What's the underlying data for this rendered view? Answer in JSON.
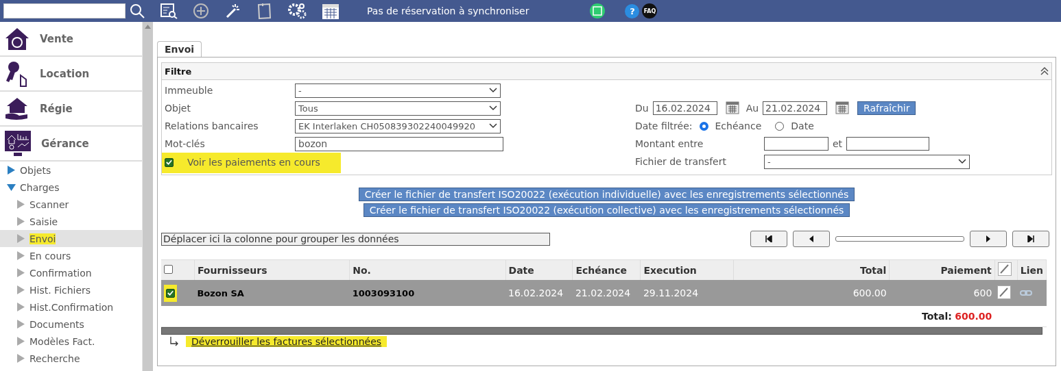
{
  "topbar": {
    "status": "Pas de réservation à synchroniser",
    "help": "?",
    "faq": "FAQ"
  },
  "sidebar": {
    "modules": [
      {
        "label": "Vente"
      },
      {
        "label": "Location"
      },
      {
        "label": "Régie"
      },
      {
        "label": "Gérance"
      }
    ],
    "tree": [
      {
        "label": "Objets",
        "expanded": false
      },
      {
        "label": "Charges",
        "expanded": true,
        "children": [
          {
            "label": "Scanner",
            "selected": false,
            "highlighted": false
          },
          {
            "label": "Saisie",
            "selected": false,
            "highlighted": false
          },
          {
            "label": "Envoi",
            "selected": true,
            "highlighted": true
          },
          {
            "label": "En cours",
            "selected": false,
            "highlighted": false
          },
          {
            "label": "Confirmation",
            "selected": false,
            "highlighted": false
          },
          {
            "label": "Hist. Fichiers",
            "selected": false,
            "highlighted": false
          },
          {
            "label": "Hist.Confirmation",
            "selected": false,
            "highlighted": false
          },
          {
            "label": "Documents",
            "selected": false,
            "highlighted": false
          },
          {
            "label": "Modèles Fact.",
            "selected": false,
            "highlighted": false
          },
          {
            "label": "Recherche",
            "selected": false,
            "highlighted": false
          }
        ]
      }
    ]
  },
  "tabs": [
    {
      "label": "Envoi",
      "selected": true
    }
  ],
  "filter": {
    "title": "Filtre",
    "fields": [
      {
        "label": "Immeuble",
        "kind": "select",
        "value": "-"
      },
      {
        "label": "Objet",
        "kind": "select",
        "value": "Tous"
      },
      {
        "label": "Relations bancaires",
        "kind": "select",
        "value": "EK Interlaken CH050839302240049920"
      },
      {
        "label": "Mot-clés",
        "kind": "text",
        "value": "bozon"
      }
    ],
    "show_pending": {
      "label": "Voir les paiements en cours",
      "checked": true,
      "highlighted": true
    },
    "from": {
      "label": "Du",
      "value": "16.02.2024"
    },
    "to": {
      "label": "Au",
      "value": "21.02.2024"
    },
    "refresh": "Rafraîchir",
    "date_filter": {
      "label": "Date filtrée:",
      "options": [
        {
          "label": "Echéance",
          "selected": true
        },
        {
          "label": "Date",
          "selected": false
        }
      ]
    },
    "amount": {
      "label": "Montant entre",
      "and": "et"
    },
    "transfer_file": {
      "label": "Fichier de transfert",
      "value": "-"
    }
  },
  "actions": [
    "Créer le fichier de transfert ISO20022 (exécution individuelle) avec les enregistrements sélectionnés",
    "Créer le fichier de transfert ISO20022 (exécution collective) avec les enregistrements sélectionnés"
  ],
  "group_hint": "Déplacer ici la colonne pour grouper les données",
  "table": {
    "all_checked": false,
    "columns": [
      "Fournisseurs",
      "No.",
      "Date",
      "Echéance",
      "Execution",
      "Total",
      "Paiement",
      "Lien"
    ],
    "rows": [
      {
        "checked": true,
        "highlighted": true,
        "cells": [
          "Bozon SA",
          "1003093100",
          "16.02.2024",
          "21.02.2024",
          "29.11.2024",
          "600.00",
          "600"
        ]
      }
    ],
    "total_label": "Total:",
    "total_value": "600.00"
  },
  "unlock": {
    "label": "Déverrouiller les factures sélectionnées",
    "highlighted": true
  }
}
